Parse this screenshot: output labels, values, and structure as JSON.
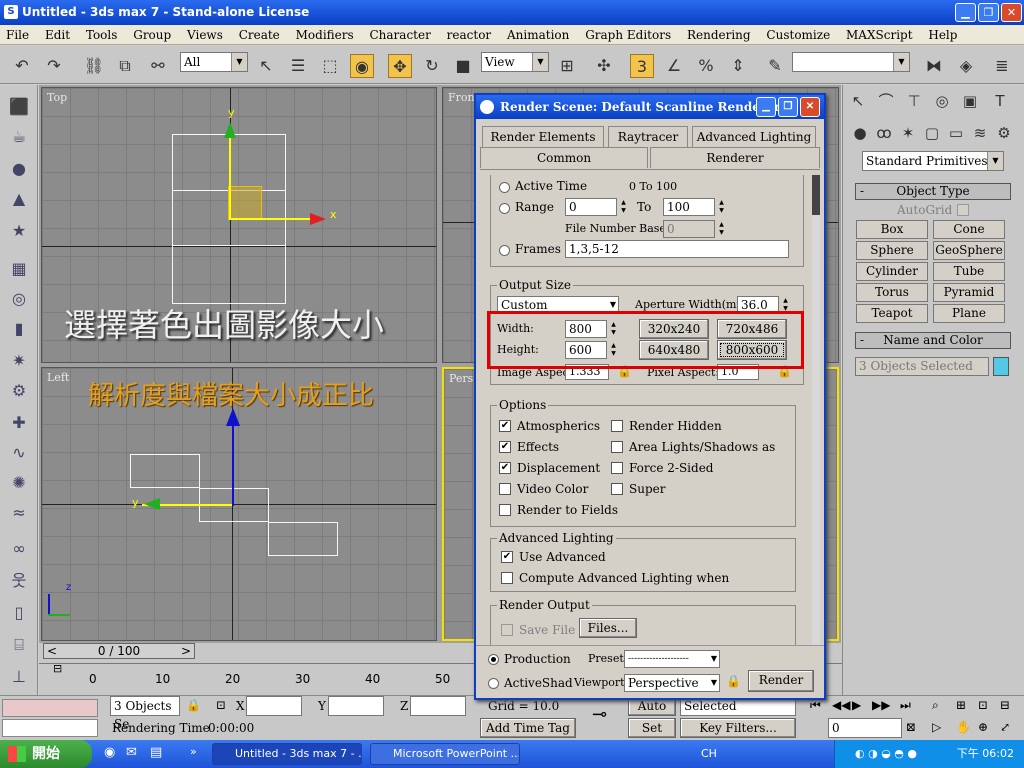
{
  "window": {
    "title": "Untitled - 3ds max 7  - Stand-alone License",
    "min_icon": "minimize-icon",
    "max_icon": "maximize-icon",
    "close_icon": "close-icon"
  },
  "menubar": [
    "File",
    "Edit",
    "Tools",
    "Group",
    "Views",
    "Create",
    "Modifiers",
    "Character",
    "reactor",
    "Animation",
    "Graph Editors",
    "Rendering",
    "Customize",
    "MAXScript",
    "Help"
  ],
  "toolbar": {
    "selection_filter": "All",
    "coord_system": "View",
    "snap_value": "3",
    "icons": [
      "undo-icon",
      "redo-icon",
      "select-link-icon",
      "unlink-icon",
      "bind-spacewarp-icon",
      "select-object-icon",
      "select-by-name-icon",
      "rect-region-icon",
      "window-crossing-icon",
      "select-move-icon",
      "select-rotate-icon",
      "select-scale-icon",
      "pivot-icon",
      "manipulate-icon",
      "snap-toggle-icon",
      "angle-snap-icon",
      "percent-snap-icon",
      "spinner-snap-icon",
      "named-selection-icon",
      "mirror-icon",
      "align-icon",
      "layer-icon"
    ]
  },
  "viewports": {
    "top": {
      "label": "Top"
    },
    "front": {
      "label": "Front"
    },
    "left": {
      "label": "Left"
    },
    "perspective": {
      "label": "Perspective"
    },
    "axis_x": "x",
    "axis_y": "y",
    "axis_z": "z"
  },
  "overlay": {
    "caption_main": "選擇著色出圖影像大小",
    "caption_sub": "解析度與檔案大小成正比"
  },
  "command_panel": {
    "category": "Standard Primitives",
    "object_type_title": "Object Type",
    "autogrid": "AutoGrid",
    "buttons": [
      "Box",
      "Cone",
      "Sphere",
      "GeoSphere",
      "Cylinder",
      "Tube",
      "Torus",
      "Pyramid",
      "Teapot",
      "Plane"
    ],
    "name_color_title": "Name and Color",
    "name_value": "3 Objects Selected",
    "color": "#55c8e8"
  },
  "dialog": {
    "title": "Render Scene: Default Scanline Renderer",
    "tabs_row1": [
      "Render Elements",
      "Raytracer",
      "Advanced Lighting"
    ],
    "tabs_row2": [
      "Common",
      "Renderer"
    ],
    "time_output": {
      "active_time_label": "Active Time",
      "active_time_value": "0 To 100",
      "range_label": "Range",
      "range_from": "0",
      "range_to_label": "To",
      "range_to": "100",
      "file_number_base_label": "File Number Base:",
      "file_number_base": "0",
      "frames_label": "Frames",
      "frames_value": "1,3,5-12"
    },
    "output_size": {
      "title": "Output Size",
      "preset": "Custom",
      "aperture_label": "Aperture Width(mm):",
      "aperture_value": "36.0",
      "width_label": "Width:",
      "width_value": "800",
      "height_label": "Height:",
      "height_value": "600",
      "presets": [
        "320x240",
        "720x486",
        "640x480",
        "800x600"
      ],
      "image_aspect_label": "Image Aspect:",
      "image_aspect_value": "1.333",
      "pixel_aspect_label": "Pixel Aspect:",
      "pixel_aspect_value": "1.0"
    },
    "options": {
      "title": "Options",
      "atmospherics": "Atmospherics",
      "render_hidden": "Render Hidden",
      "effects": "Effects",
      "area_lights": "Area Lights/Shadows as",
      "displacement": "Displacement",
      "force_2sided": "Force 2-Sided",
      "video_color": "Video Color",
      "super": "Super",
      "render_fields": "Render to Fields"
    },
    "advanced_lighting": {
      "title": "Advanced Lighting",
      "use_advanced": "Use Advanced",
      "compute": "Compute Advanced Lighting when"
    },
    "render_output": {
      "title": "Render Output",
      "save_file": "Save File",
      "files_button": "Files..."
    },
    "bottom": {
      "production": "Production",
      "activeshade": "ActiveShad",
      "preset_label": "Preset:",
      "preset_value": "--------------------",
      "viewport_label": "Viewport:",
      "viewport_value": "Perspective",
      "render_button": "Render"
    }
  },
  "timeline": {
    "slider_prev": "<",
    "slider_text": "0 / 100",
    "slider_next": ">",
    "ticks": [
      "0",
      "10",
      "20",
      "30",
      "40",
      "50"
    ]
  },
  "status": {
    "selection": "3 Objects Se",
    "x_label": "X",
    "y_label": "Y",
    "z_label": "Z",
    "rendering_time_label": "Rendering Time",
    "rendering_time_value": "0:00:00",
    "grid": "Grid = 10.0",
    "add_time_tag": "Add Time Tag",
    "auto_key": "Auto Key",
    "selected": "Selected",
    "set_key": "Set Key",
    "key_filters": "Key Filters...",
    "frame": "0"
  },
  "taskbar": {
    "start": "開始",
    "items": [
      "Untitled - 3ds max 7 - ...",
      "Microsoft PowerPoint ..."
    ],
    "ime": "CH",
    "clock": "下午 06:02"
  }
}
